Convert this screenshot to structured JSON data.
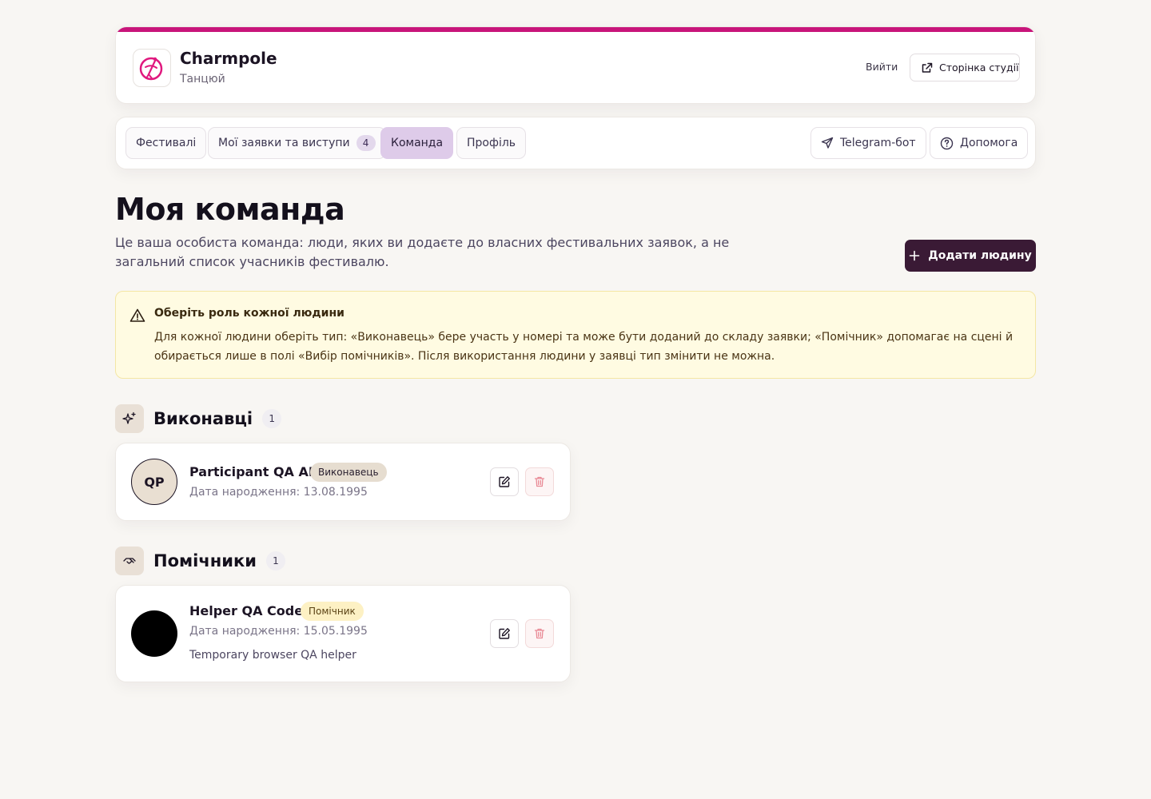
{
  "header": {
    "brand_name": "Charmpole",
    "brand_sub": "Танцюй",
    "logout_label": "Вийти",
    "studio_label": "Сторінка студії"
  },
  "nav": {
    "tabs": [
      {
        "label": "Фестивалі"
      },
      {
        "label": "Мої заявки та виступи",
        "count": "4"
      },
      {
        "label": "Команда",
        "active": true
      },
      {
        "label": "Профіль"
      }
    ],
    "telegram_label": "Telegram-бот",
    "help_label": "Допомога"
  },
  "page": {
    "title": "Моя команда",
    "description": "Це ваша особиста команда: люди, яких ви додаєте до власних фестивальних заявок, а не загальний список учасників фестивалю.",
    "add_button": "Додати людину"
  },
  "alert": {
    "title": "Оберіть роль кожної людини",
    "text": "Для кожної людини оберіть тип: «Виконавець» бере участь у номері та може бути доданий до складу заявки; «Помічник» допомагає на сцені й обирається лише в полі «Вибір помічників». Після використання людини у заявці тип змінити не можна."
  },
  "sections": {
    "performers": {
      "title": "Виконавці",
      "count": "1",
      "people": [
        {
          "initials": "QP",
          "name": "Participant QA APP",
          "badge": "Виконавець",
          "dob": "Дата народження: 13.08.1995"
        }
      ]
    },
    "helpers": {
      "title": "Помічники",
      "count": "1",
      "people": [
        {
          "name": "Helper QA Codex",
          "badge": "Помічник",
          "dob": "Дата народження: 15.05.1995",
          "note": "Temporary browser QA helper"
        }
      ]
    }
  },
  "colors": {
    "accent": "#c8157a",
    "primary_button": "#3a1a35",
    "active_tab": "#decbe9",
    "alert_bg": "#fffbe2",
    "danger": "#e98a96"
  }
}
